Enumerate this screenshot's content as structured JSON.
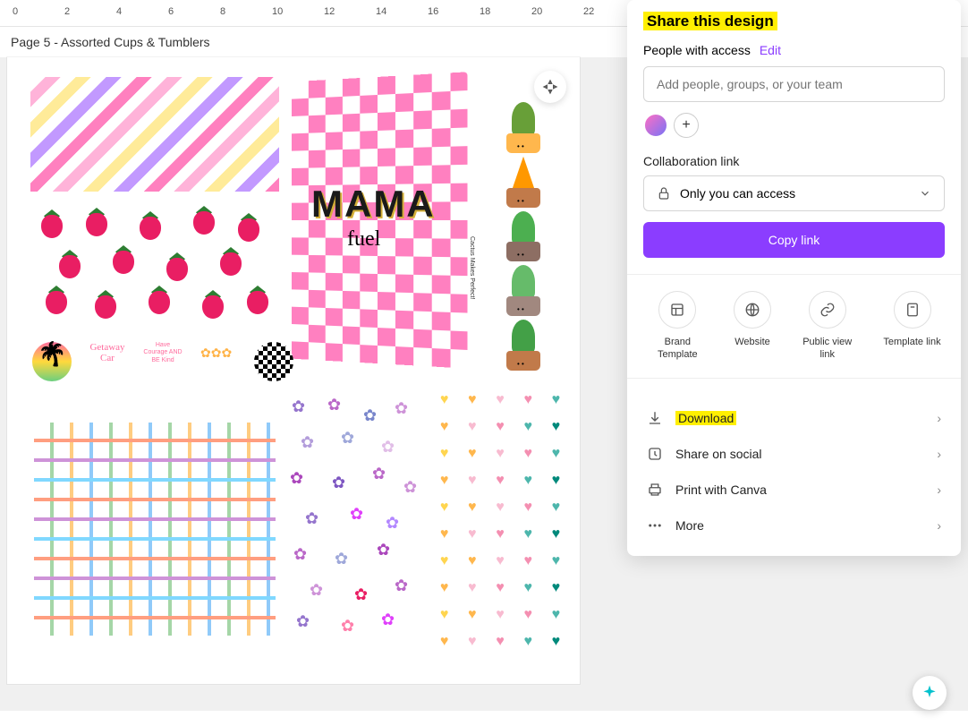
{
  "ruler": {
    "marks": [
      "0",
      "2",
      "4",
      "6",
      "8",
      "10",
      "12",
      "14",
      "16",
      "18",
      "20",
      "22"
    ]
  },
  "page": {
    "title": "Page 5 - Assorted Cups & Tumblers"
  },
  "canvas": {
    "mama_text": "MAMA",
    "fuel_text": "fuel",
    "cactus_text": "Cactus Makes Perfect!",
    "getaway": "Getaway Car",
    "courage": "Have Courage AND BE Kind"
  },
  "share": {
    "title": "Share this design",
    "access_label": "People with access",
    "edit": "Edit",
    "people_placeholder": "Add people, groups, or your team",
    "collab_label": "Collaboration link",
    "collab_value": "Only you can access",
    "copy_btn": "Copy link",
    "options": [
      {
        "label": "Brand Template"
      },
      {
        "label": "Website"
      },
      {
        "label": "Public view link"
      },
      {
        "label": "Template link"
      }
    ],
    "menu": {
      "download": "Download",
      "social": "Share on social",
      "print": "Print with Canva",
      "more": "More"
    }
  }
}
